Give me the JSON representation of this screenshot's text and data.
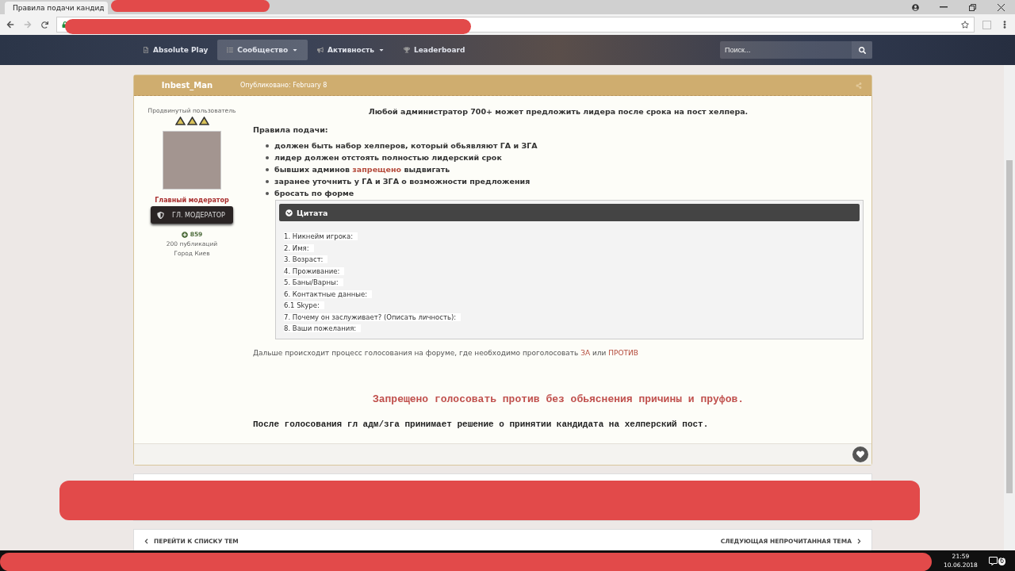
{
  "browser": {
    "tabs": [
      {
        "title": "Правила подачи кандид",
        "selected": true
      }
    ]
  },
  "nav": {
    "items": [
      {
        "label": "Absolute Play",
        "dropdown": false,
        "selected": false
      },
      {
        "label": "Сообщество",
        "dropdown": true,
        "selected": true
      },
      {
        "label": "Активность",
        "dropdown": true,
        "selected": false
      },
      {
        "label": "Leaderboard",
        "dropdown": false,
        "selected": false
      }
    ],
    "search": {
      "placeholder": "Поиск..."
    }
  },
  "post": {
    "author": "Inbest_Man",
    "published": "Опубликовано: February 8",
    "author_panel": {
      "title": "Продвинутый пользователь",
      "group": "Главный модератор",
      "badge": "ГЛ. МОДЕРАТОР",
      "reputation": "859",
      "posts": "200 публикаций",
      "location": "Город Киев"
    },
    "lead": "Любой администратор 700+ может предложить лидера после срока на пост хелпера.",
    "rules_title": "Правила подачи:",
    "rules": [
      [
        {
          "text": "должен быть набор хелперов, который обьявляют ГА и ЗГА",
          "kind": "plain"
        }
      ],
      [
        {
          "text": "лидер должен отстоять полностью лидерский срок",
          "kind": "plain"
        }
      ],
      [
        {
          "text": "бывших админов ",
          "kind": "plain"
        },
        {
          "text": "запрещено",
          "kind": "accent"
        },
        {
          "text": " выдвигать",
          "kind": "plain"
        }
      ],
      [
        {
          "text": "заранее уточнить у ГА и ЗГА о возможности предложения",
          "kind": "plain"
        }
      ],
      [
        {
          "text": "бросать по форме",
          "kind": "plain"
        }
      ]
    ],
    "quote": {
      "title": "Цитата",
      "lines": [
        "1. Никнейм игрока:",
        "2. Имя:",
        "3. Возраст:",
        "4. Проживание:",
        "5. Баны/Варны:",
        "6. Контактные данные:",
        "6.1 Skype:",
        "7. Почему он заслуживает? (Описать личность):",
        "8. Ваши пожелания:"
      ]
    },
    "voting": [
      {
        "text": "Дальше происходит процесс голосования на форуме, где необходимо проголосовать ",
        "kind": "plain"
      },
      {
        "text": "ЗА",
        "kind": "link"
      },
      {
        "text": " или ",
        "kind": "plain"
      },
      {
        "text": "ПРОТИВ",
        "kind": "link"
      }
    ],
    "warning": "Запрещено голосовать против без обьяснения причины и пруфов.",
    "decision": "После голосования гл адм/зга принимает решение о принятии кандидата на хелперский пост."
  },
  "pager": {
    "previous": "ПЕРЕЙТИ К СПИСКУ ТЕМ",
    "next": "СЛЕДУЮЩАЯ НЕПРОЧИТАННАЯ ТЕМА"
  },
  "taskbar": {
    "time": "21:59",
    "date": "10.06.2018",
    "notifications": "6"
  }
}
